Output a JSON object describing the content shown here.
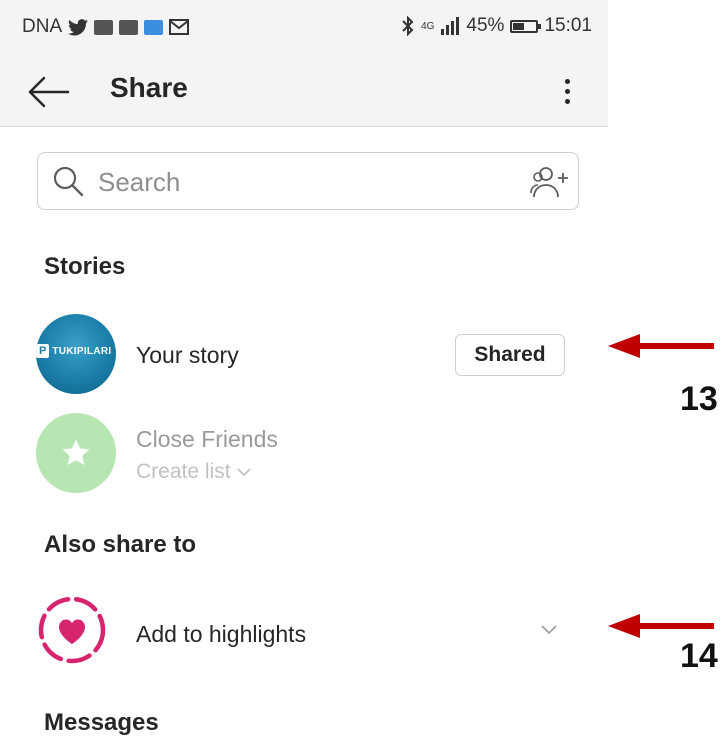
{
  "statusbar": {
    "carrier": "DNA",
    "network": "4G",
    "battery": "45%",
    "battery_level": 0.45,
    "time": "15:01",
    "icons": [
      "twitter-icon",
      "app-icon",
      "app-icon",
      "app-icon",
      "mail-icon",
      "bluetooth-icon",
      "signal-icon",
      "battery-icon"
    ]
  },
  "appbar": {
    "title": "Share",
    "back_icon": "arrow-left-icon",
    "more_icon": "more-vertical-icon"
  },
  "search": {
    "placeholder": "Search",
    "search_icon": "search-icon",
    "add_icon": "add-user-icon"
  },
  "stories": {
    "header": "Stories",
    "your_story": {
      "label": "Your story",
      "avatar_text": "TUKIPILARI",
      "avatar_mark": "P",
      "button": "Shared"
    },
    "close_friends": {
      "label": "Close Friends",
      "sub": "Create list",
      "icon": "star-icon"
    }
  },
  "also_share": {
    "header": "Also share to",
    "highlights": {
      "label": "Add to highlights",
      "icon": "heart-icon",
      "chevron": "chevron-down-icon"
    }
  },
  "messages": {
    "header": "Messages"
  },
  "annotations": [
    {
      "number": "13",
      "color": "#c00000"
    },
    {
      "number": "14",
      "color": "#c00000"
    }
  ],
  "colors": {
    "accent_pink": "#d6246e",
    "close_friends_green": "#b7e6b2",
    "arrow_red": "#c00000"
  }
}
